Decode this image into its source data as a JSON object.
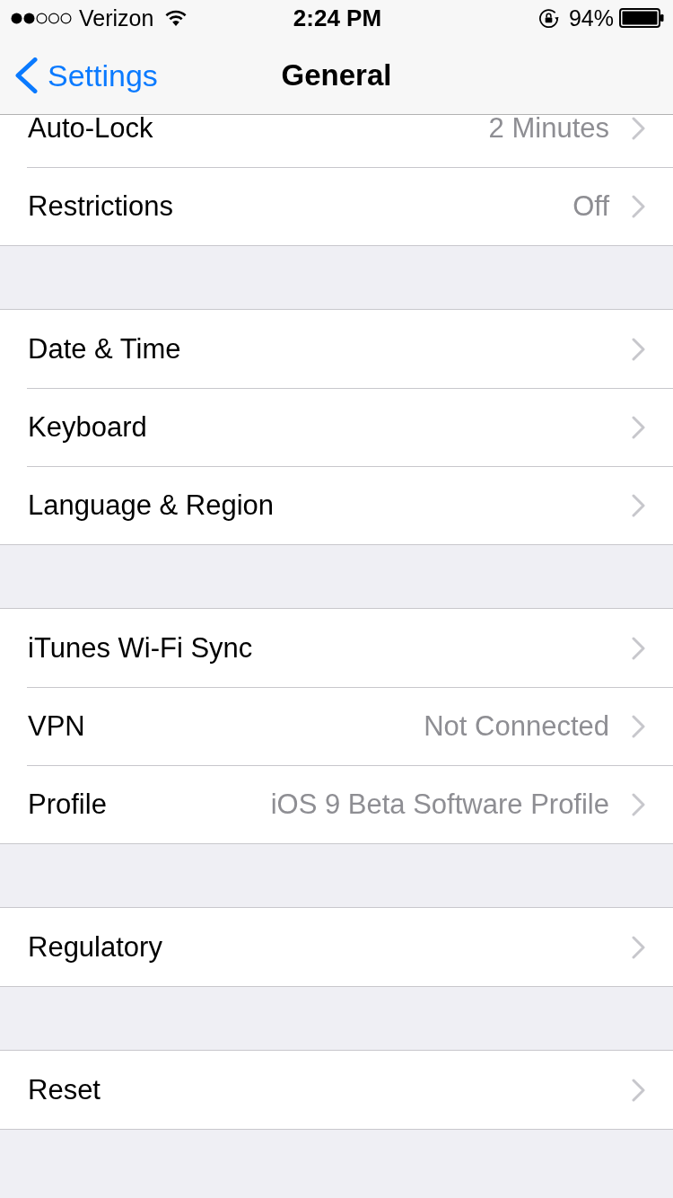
{
  "status_bar": {
    "carrier": "Verizon",
    "time": "2:24 PM",
    "battery": "94%"
  },
  "nav_bar": {
    "back_label": "Settings",
    "title": "General"
  },
  "groups": [
    {
      "rows": [
        {
          "label": "Auto-Lock",
          "value": "2 Minutes"
        },
        {
          "label": "Restrictions",
          "value": "Off"
        }
      ]
    },
    {
      "rows": [
        {
          "label": "Date & Time"
        },
        {
          "label": "Keyboard"
        },
        {
          "label": "Language & Region"
        }
      ]
    },
    {
      "rows": [
        {
          "label": "iTunes Wi-Fi Sync"
        },
        {
          "label": "VPN",
          "value": "Not Connected"
        },
        {
          "label": "Profile",
          "value": "iOS 9 Beta Software Profile"
        }
      ]
    },
    {
      "rows": [
        {
          "label": "Regulatory"
        }
      ]
    },
    {
      "rows": [
        {
          "label": "Reset"
        }
      ]
    }
  ]
}
